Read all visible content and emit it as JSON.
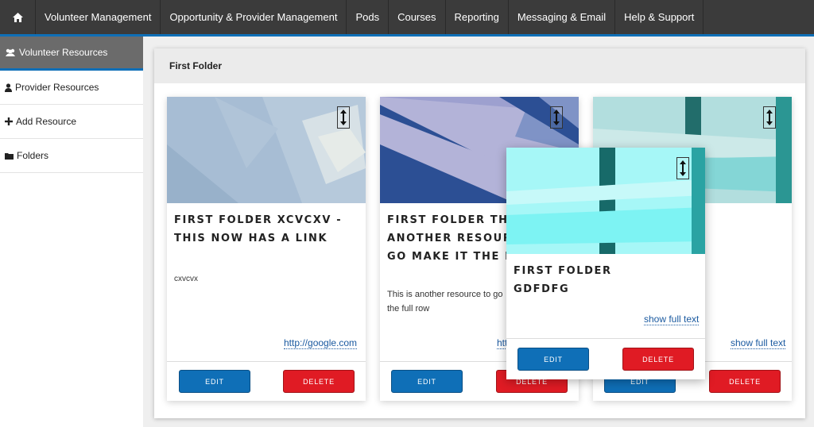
{
  "nav": {
    "items": [
      "Volunteer Management",
      "Opportunity & Provider Management",
      "Pods",
      "Courses",
      "Reporting",
      "Messaging & Email",
      "Help & Support"
    ]
  },
  "sidebar": {
    "items": [
      {
        "label": "Volunteer Resources",
        "icon": "users-icon"
      },
      {
        "label": "Provider Resources",
        "icon": "user-icon"
      },
      {
        "label": "Add Resource",
        "icon": "plus-icon"
      },
      {
        "label": "Folders",
        "icon": "folder-icon"
      }
    ]
  },
  "panel": {
    "title": "First Folder"
  },
  "cards": [
    {
      "title": "FIRST FOLDER XCVCXV - THIS NOW HAS A LINK",
      "description": "cxvcvx",
      "link": "http://google.com",
      "edit": "EDIT",
      "delete": "DELETE"
    },
    {
      "title": "FIRST FOLDER THIS IS ANOTHER RESOURCE TO GO MAKE IT THE FULL",
      "description": "This is another resource to go the full row",
      "link": "htt",
      "edit": "EDIT",
      "delete": "DELETE"
    },
    {
      "title": "",
      "description": "",
      "link": "show full text",
      "edit": "EDIT",
      "delete": "DELETE"
    },
    {
      "title": "FIRST FOLDER GDFDFG",
      "description": "",
      "link": "show full text",
      "edit": "EDIT",
      "delete": "DELETE"
    }
  ],
  "colors": {
    "accent": "#0f6fb7",
    "danger": "#e01b24",
    "nav_bg": "#3b3b3b"
  }
}
